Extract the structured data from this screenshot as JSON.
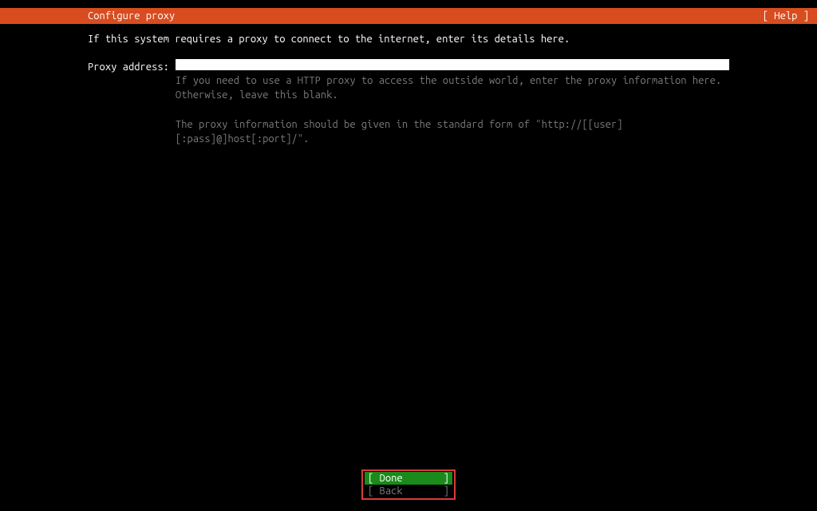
{
  "header": {
    "title": "Configure proxy",
    "help_bracket": "[ Help ]"
  },
  "main": {
    "description": "If this system requires a proxy to connect to the internet, enter its details here.",
    "field_label": "Proxy address:",
    "input_value": "",
    "help_line1": "If you need to use a HTTP proxy to access the outside world, enter the proxy information here. Otherwise, leave this blank.",
    "help_line2": "The proxy information should be given in the standard form of \"http://[[user][:pass]@]host[:port]/\"."
  },
  "footer": {
    "done_label": "[ Done       ]",
    "back_label": "[ Back       ]"
  }
}
